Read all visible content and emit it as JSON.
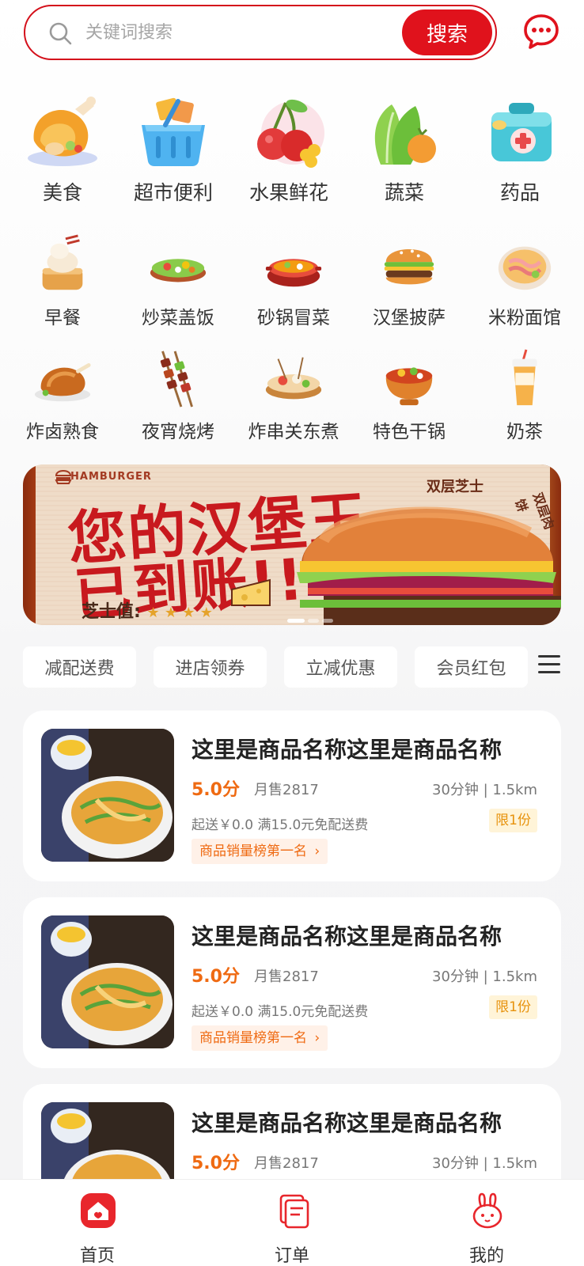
{
  "search": {
    "placeholder": "关键词搜索",
    "button_label": "搜索"
  },
  "categories_main": [
    {
      "label": "美食",
      "icon": "roast-chicken-icon"
    },
    {
      "label": "超市便利",
      "icon": "shopping-basket-icon"
    },
    {
      "label": "水果鲜花",
      "icon": "cherry-flower-icon"
    },
    {
      "label": "蔬菜",
      "icon": "vegetable-icon"
    },
    {
      "label": "药品",
      "icon": "medicine-box-icon"
    }
  ],
  "categories_row2": [
    {
      "label": "早餐",
      "icon": "steamed-bun-icon"
    },
    {
      "label": "炒菜盖饭",
      "icon": "stir-fry-icon"
    },
    {
      "label": "砂锅冒菜",
      "icon": "clay-pot-icon"
    },
    {
      "label": "汉堡披萨",
      "icon": "burger-icon"
    },
    {
      "label": "米粉面馆",
      "icon": "noodle-bowl-icon"
    }
  ],
  "categories_row3": [
    {
      "label": "炸卤熟食",
      "icon": "roast-duck-icon"
    },
    {
      "label": "夜宵烧烤",
      "icon": "skewer-icon"
    },
    {
      "label": "炸串关东煮",
      "icon": "oden-icon"
    },
    {
      "label": "特色干锅",
      "icon": "dry-pot-icon"
    },
    {
      "label": "奶茶",
      "icon": "milk-tea-icon"
    }
  ],
  "banner": {
    "tag": "HAMBURGER",
    "headline_1": "您的汉堡王",
    "headline_2": "已到账!!",
    "label_1": "双层芝士",
    "label_2": "双层肉饼",
    "rating_label": "芝士值:"
  },
  "filters": [
    "减配送费",
    "进店领券",
    "立减优惠",
    "会员红包"
  ],
  "products": [
    {
      "name": "这里是商品名称这里是商品名称",
      "score": "5.0分",
      "sold": "月售2817",
      "distance": "30分钟 | 1.5km",
      "fee": "起送￥0.0 满15.0元免配送费",
      "limit": "限1份",
      "rank": "商品销量榜第一名"
    },
    {
      "name": "这里是商品名称这里是商品名称",
      "score": "5.0分",
      "sold": "月售2817",
      "distance": "30分钟 | 1.5km",
      "fee": "起送￥0.0 满15.0元免配送费",
      "limit": "限1份",
      "rank": "商品销量榜第一名"
    },
    {
      "name": "这里是商品名称这里是商品名称",
      "score": "5.0分",
      "sold": "月售2817",
      "distance": "30分钟 | 1.5km"
    }
  ],
  "tabs": [
    {
      "label": "首页",
      "icon": "home-icon",
      "active": true
    },
    {
      "label": "订单",
      "icon": "order-icon",
      "active": false
    },
    {
      "label": "我的",
      "icon": "profile-rabbit-icon",
      "active": false
    }
  ],
  "colors": {
    "brand_red": "#e0121c",
    "accent_orange": "#ef6a12",
    "limit_yellow": "#e7920c"
  }
}
